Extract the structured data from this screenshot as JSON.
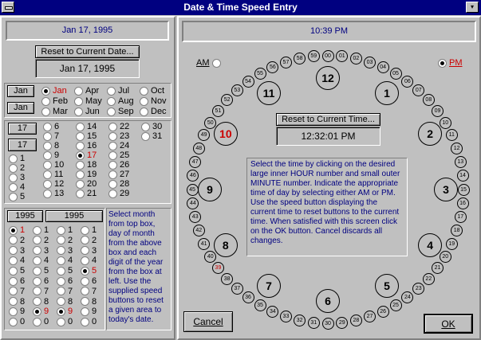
{
  "window": {
    "title": "Date & Time Speed Entry",
    "restore_glyph": "▾"
  },
  "date_panel": {
    "display": "Jan 17, 1995",
    "reset_label": "Reset to Current Date...",
    "current_value": "Jan 17, 1995",
    "month": {
      "speed_top": "Jan",
      "speed_bottom": "Jan",
      "options": [
        {
          "label": "Jan",
          "selected": true
        },
        {
          "label": "Feb",
          "selected": false
        },
        {
          "label": "Mar",
          "selected": false
        },
        {
          "label": "Apr",
          "selected": false
        },
        {
          "label": "May",
          "selected": false
        },
        {
          "label": "Jun",
          "selected": false
        },
        {
          "label": "Jul",
          "selected": false
        },
        {
          "label": "Aug",
          "selected": false
        },
        {
          "label": "Sep",
          "selected": false
        },
        {
          "label": "Oct",
          "selected": false
        },
        {
          "label": "Nov",
          "selected": false
        },
        {
          "label": "Dec",
          "selected": false
        }
      ]
    },
    "day": {
      "speed_top": "17",
      "speed_bottom": "17",
      "tens": [
        "1",
        "2",
        "3",
        "4",
        "5"
      ],
      "cols": [
        [
          "6",
          "7",
          "8",
          "9",
          "10",
          "11",
          "12",
          "13"
        ],
        [
          "14",
          "15",
          "16",
          "17",
          "18",
          "19",
          "20",
          "21"
        ],
        [
          "22",
          "23",
          "24",
          "25",
          "26",
          "27",
          "28",
          "29"
        ],
        [
          "30",
          "31"
        ]
      ],
      "selected": "17"
    },
    "year": {
      "speed_left": "1995",
      "speed_right": "1995",
      "digits": [
        "1",
        "2",
        "3",
        "4",
        "5",
        "6",
        "7",
        "8",
        "9",
        "0"
      ],
      "selected": [
        "1",
        "9",
        "9",
        "5"
      ]
    },
    "help": "Select month from top box, day of month from the above box and each digit of the year from the box at left.  Use the supplied speed buttons to reset a given area to today's date."
  },
  "time_panel": {
    "display": "10:39 PM",
    "am_label": "AM",
    "pm_label": "PM",
    "period": "PM",
    "reset_label": "Reset to Current Time...",
    "current_value": "12:32:01 PM",
    "selected_hour": "10",
    "selected_minute": "39",
    "hours": [
      "12",
      "1",
      "2",
      "3",
      "4",
      "5",
      "6",
      "7",
      "8",
      "9",
      "10",
      "11"
    ],
    "minutes": [
      "00",
      "01",
      "02",
      "03",
      "04",
      "05",
      "06",
      "07",
      "08",
      "09",
      "10",
      "11",
      "12",
      "13",
      "14",
      "15",
      "16",
      "17",
      "18",
      "19",
      "20",
      "21",
      "22",
      "23",
      "24",
      "25",
      "26",
      "27",
      "28",
      "29",
      "30",
      "31",
      "32",
      "33",
      "34",
      "35",
      "36",
      "37",
      "38",
      "39",
      "40",
      "41",
      "42",
      "43",
      "44",
      "45",
      "46",
      "47",
      "48",
      "49",
      "50",
      "51",
      "52",
      "53",
      "54",
      "55",
      "56",
      "57",
      "58",
      "59"
    ],
    "help": "Select the time by clicking on the desired large inner HOUR number and small outer MINUTE number. Indicate the appropriate time of day by selecting either AM or PM. Use the speed button displaying the current time to reset buttons to the current time. When satisfied with this screen click on the OK button. Cancel discards all changes."
  },
  "buttons": {
    "cancel": "Cancel",
    "ok": "OK"
  }
}
